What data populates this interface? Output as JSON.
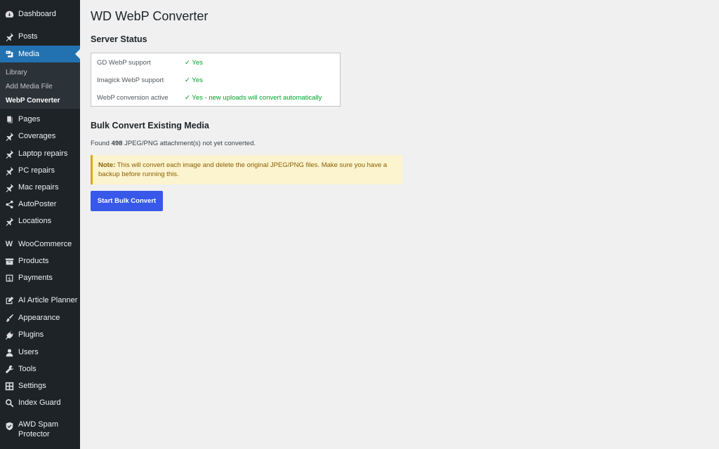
{
  "page": {
    "title": "WD WebP Converter"
  },
  "sidebar": {
    "items": [
      {
        "label": "Dashboard",
        "icon": "dashboard-icon"
      },
      {
        "label": "Posts",
        "icon": "pin-icon"
      },
      {
        "label": "Media",
        "icon": "media-icon",
        "current": true
      },
      {
        "label": "Pages",
        "icon": "pages-icon"
      },
      {
        "label": "Coverages",
        "icon": "pin-icon"
      },
      {
        "label": "Laptop repairs",
        "icon": "pin-icon"
      },
      {
        "label": "PC repairs",
        "icon": "pin-icon"
      },
      {
        "label": "Mac repairs",
        "icon": "pin-icon"
      },
      {
        "label": "AutoPoster",
        "icon": "share-icon"
      },
      {
        "label": "Locations",
        "icon": "pin-icon"
      },
      {
        "label": "WooCommerce",
        "icon": "woo-icon"
      },
      {
        "label": "Products",
        "icon": "archive-icon"
      },
      {
        "label": "Payments",
        "icon": "dollar-icon"
      },
      {
        "label": "AI Article Planner",
        "icon": "edit-icon"
      },
      {
        "label": "Appearance",
        "icon": "brush-icon"
      },
      {
        "label": "Plugins",
        "icon": "plugin-icon"
      },
      {
        "label": "Users",
        "icon": "user-icon"
      },
      {
        "label": "Tools",
        "icon": "wrench-icon"
      },
      {
        "label": "Settings",
        "icon": "settings-icon"
      },
      {
        "label": "Index Guard",
        "icon": "search-icon"
      },
      {
        "label": "AWD Spam Protector",
        "icon": "shield-icon"
      }
    ],
    "media_submenu": [
      {
        "label": "Library"
      },
      {
        "label": "Add Media File"
      },
      {
        "label": "WebP Converter",
        "active": true
      }
    ]
  },
  "server_status": {
    "heading": "Server Status",
    "rows": [
      {
        "label": "GD WebP support",
        "value": "✓ Yes"
      },
      {
        "label": "Imagick WebP support",
        "value": "✓ Yes"
      },
      {
        "label": "WebP conversion active",
        "value": "✓ Yes - new uploads will convert automatically"
      }
    ],
    "ok_color": "#00a32a"
  },
  "bulk": {
    "heading": "Bulk Convert Existing Media",
    "found_prefix": "Found ",
    "found_count": "498",
    "found_suffix": " JPEG/PNG attachment(s) not yet converted.",
    "notice_label": "Note:",
    "notice_text": " This will convert each image and delete the original JPEG/PNG files. Make sure you have a backup before running this.",
    "button_label": "Start Bulk Convert",
    "button_color": "#3858e9"
  }
}
